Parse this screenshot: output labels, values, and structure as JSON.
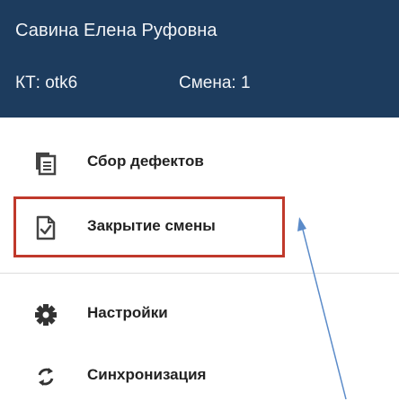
{
  "header": {
    "user_name": "Савина Елена Руфовна",
    "kt": "КТ: otk6",
    "shift": "Смена: 1"
  },
  "menu": {
    "items": [
      {
        "label": "Сбор дефектов",
        "icon": "copy-document-icon"
      },
      {
        "label": "Закрытие смены",
        "icon": "document-check-icon"
      },
      {
        "label": "Настройки",
        "icon": "gear-icon"
      },
      {
        "label": "Синхронизация",
        "icon": "sync-icon"
      }
    ]
  },
  "colors": {
    "header_bg": "#1d3c5e",
    "highlight_border": "#c0392b",
    "annotation_arrow": "#5b8bc9"
  }
}
